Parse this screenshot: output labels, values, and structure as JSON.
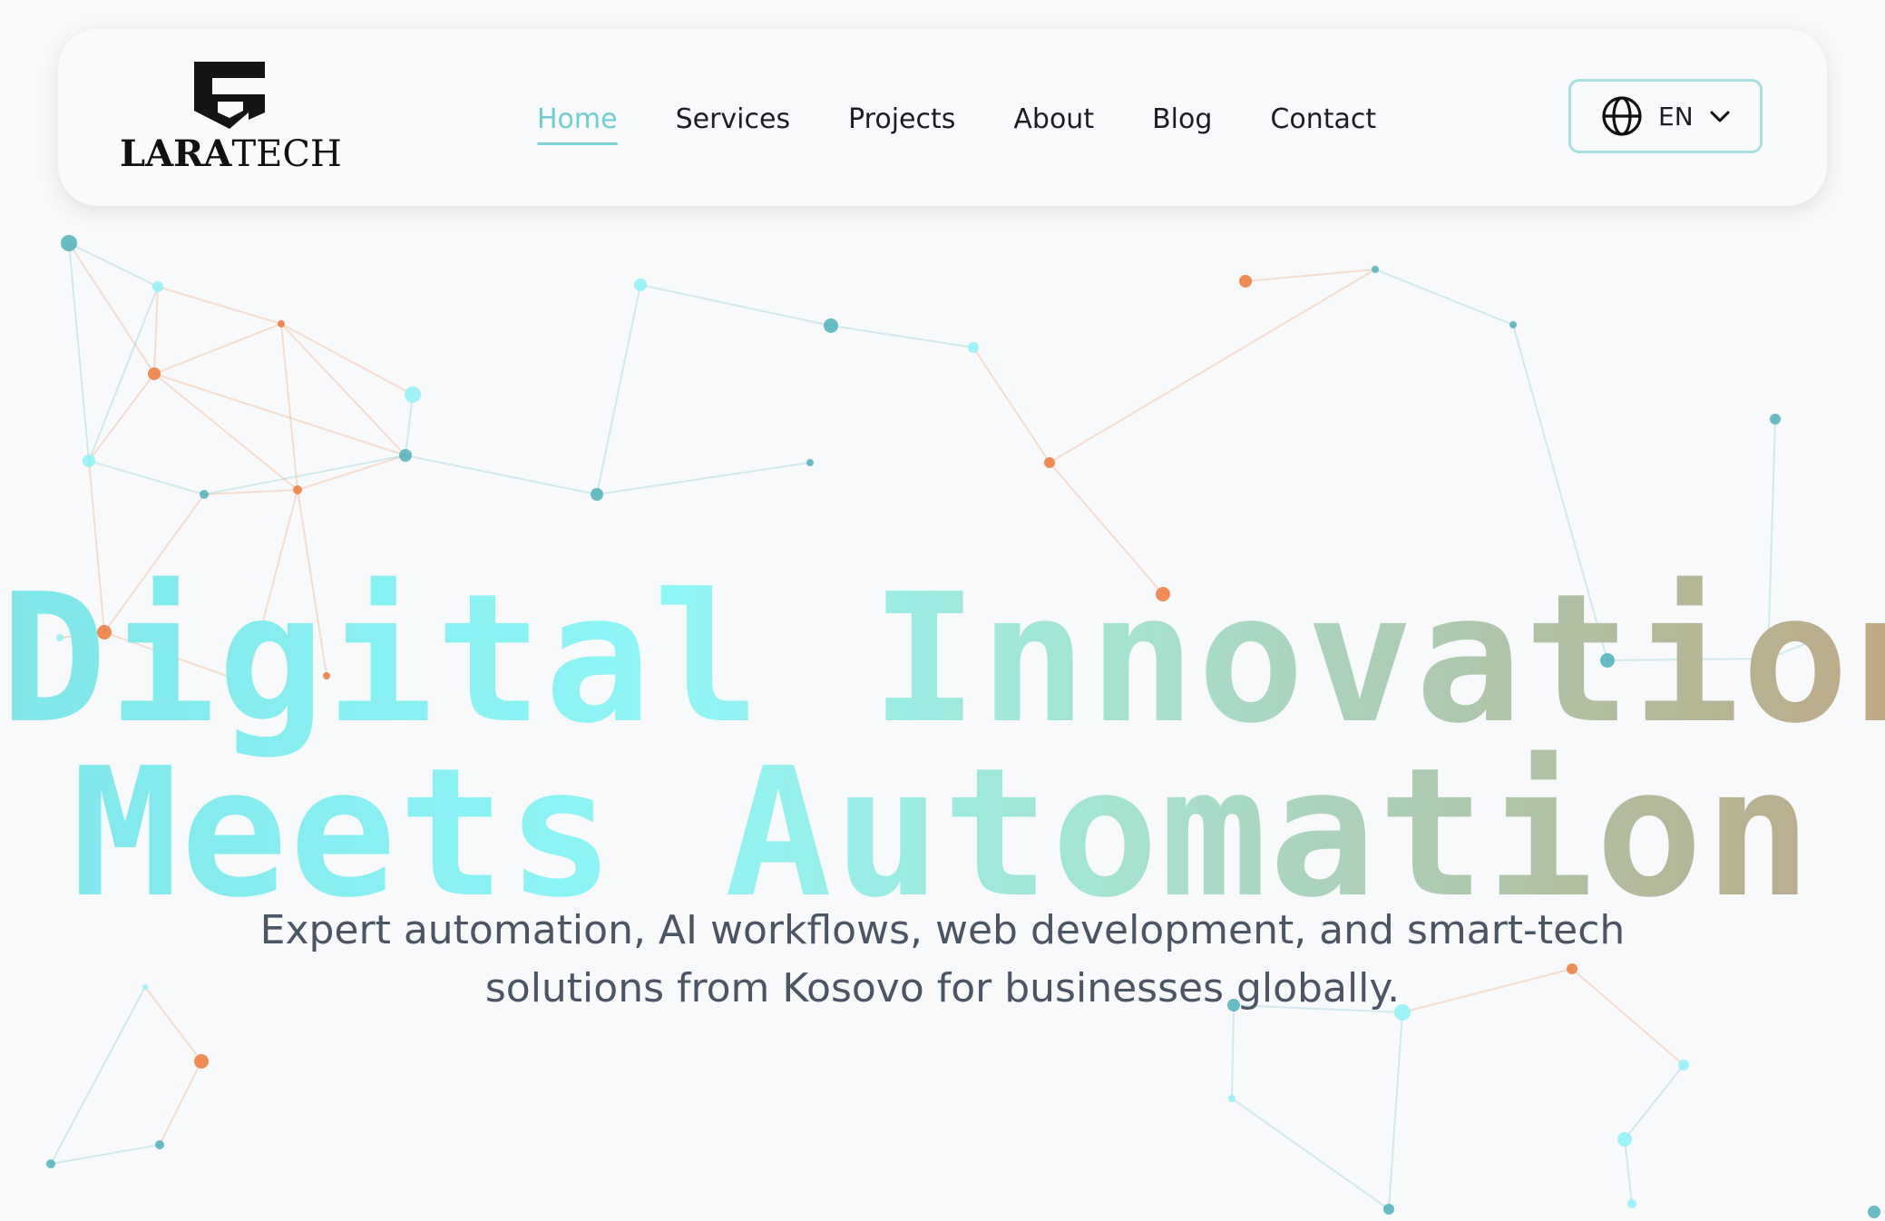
{
  "brand": {
    "name_bold": "LARA",
    "name_light": "TECH"
  },
  "nav": {
    "items": [
      {
        "label": "Home",
        "active": true
      },
      {
        "label": "Services",
        "active": false
      },
      {
        "label": "Projects",
        "active": false
      },
      {
        "label": "About",
        "active": false
      },
      {
        "label": "Blog",
        "active": false
      },
      {
        "label": "Contact",
        "active": false
      }
    ],
    "language": {
      "label": "EN",
      "icon": "globe-icon",
      "dropdown_icon": "chevron-down-icon"
    }
  },
  "hero": {
    "title_line1": "Digital Innovation",
    "title_line2": "Meets Automation",
    "subtitle": "Expert automation, AI workflows, web development, and smart-tech solutions from Kosovo for businesses globally."
  },
  "colors": {
    "accent": "#6dcfcf",
    "border_accent": "#a9dfdf",
    "gradient_start": "#7fe6ea",
    "gradient_end": "#bfaa87",
    "node_teal": "#4fb3bb",
    "node_cyan": "#8ff3f8",
    "node_orange": "#ee7a3a",
    "background": "#f7f9fa",
    "text_dark": "#1b1f24",
    "text_muted": "#4b5563"
  }
}
